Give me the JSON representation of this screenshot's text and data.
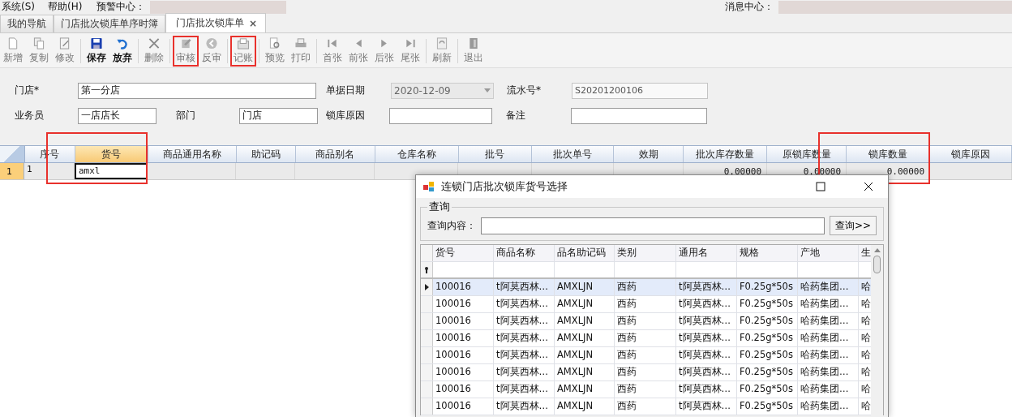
{
  "menu_bar": {
    "items": [
      "系统(S)",
      "帮助(H)"
    ],
    "alert_label": "预警中心：",
    "message_label": "消息中心："
  },
  "tabs": [
    {
      "label": "我的导航",
      "selected": false
    },
    {
      "label": "门店批次锁库单序时簿",
      "selected": false
    },
    {
      "label": "门店批次锁库单",
      "selected": true,
      "close": "×"
    }
  ],
  "toolbar": {
    "groups": [
      [
        {
          "label": "新增",
          "kind": "new",
          "disabled": true,
          "highlighted": false
        },
        {
          "label": "复制",
          "kind": "copy",
          "disabled": true,
          "highlighted": false
        },
        {
          "label": "修改",
          "kind": "edit",
          "disabled": true,
          "highlighted": false
        }
      ],
      [
        {
          "label": "保存",
          "kind": "save",
          "disabled": false,
          "highlighted": false
        },
        {
          "label": "放弃",
          "kind": "undo",
          "disabled": false,
          "highlighted": false
        }
      ],
      [
        {
          "label": "删除",
          "kind": "delete",
          "disabled": true,
          "highlighted": false
        }
      ],
      [
        {
          "label": "审核",
          "kind": "audit",
          "disabled": true,
          "highlighted": true
        },
        {
          "label": "反审",
          "kind": "back",
          "disabled": true,
          "highlighted": false
        }
      ],
      [
        {
          "label": "记账",
          "kind": "post",
          "disabled": true,
          "highlighted": true
        }
      ],
      [
        {
          "label": "预览",
          "kind": "preview",
          "disabled": true,
          "highlighted": false
        },
        {
          "label": "打印",
          "kind": "print",
          "disabled": true,
          "highlighted": false
        }
      ],
      [
        {
          "label": "首张",
          "kind": "first",
          "disabled": true,
          "highlighted": false
        },
        {
          "label": "前张",
          "kind": "prev",
          "disabled": true,
          "highlighted": false
        },
        {
          "label": "后张",
          "kind": "next",
          "disabled": true,
          "highlighted": false
        },
        {
          "label": "尾张",
          "kind": "last",
          "disabled": true,
          "highlighted": false
        }
      ],
      [
        {
          "label": "刷新",
          "kind": "refresh",
          "disabled": true,
          "highlighted": false
        }
      ],
      [
        {
          "label": "退出",
          "kind": "exit",
          "disabled": true,
          "highlighted": false
        }
      ]
    ]
  },
  "form": {
    "fields": [
      {
        "label": "门店*",
        "value": "第一分店",
        "kind": "text",
        "disabled": false
      },
      {
        "label": "单据日期",
        "value": "2020-12-09",
        "kind": "date",
        "disabled": true
      },
      {
        "label": "流水号*",
        "value": "S20201200106",
        "kind": "text",
        "disabled": true
      },
      {
        "label": "业务员",
        "value": "一店店长",
        "kind": "text",
        "disabled": false
      },
      {
        "label": "部门",
        "value": "门店",
        "kind": "text",
        "disabled": false
      },
      {
        "label": "锁库原因",
        "kind": "text",
        "disabled": false
      },
      {
        "label": "备注",
        "kind": "text",
        "disabled": false
      }
    ]
  },
  "grid": {
    "columns": [
      {
        "label": "序号",
        "selected": false,
        "highlighted": false
      },
      {
        "label": "货号",
        "selected": true,
        "highlighted": true
      },
      {
        "label": "商品通用名称",
        "selected": false,
        "highlighted": false
      },
      {
        "label": "助记码",
        "selected": false,
        "highlighted": false
      },
      {
        "label": "商品别名",
        "selected": false,
        "highlighted": false
      },
      {
        "label": "仓库名称",
        "selected": false,
        "highlighted": false
      },
      {
        "label": "批号",
        "selected": false,
        "highlighted": false
      },
      {
        "label": "批次单号",
        "selected": false,
        "highlighted": false
      },
      {
        "label": "效期",
        "selected": false,
        "highlighted": false
      },
      {
        "label": "批次库存数量",
        "selected": false,
        "highlighted": false
      },
      {
        "label": "原锁库数量",
        "selected": false,
        "highlighted": false
      },
      {
        "label": "锁库数量",
        "selected": false,
        "highlighted": true
      },
      {
        "label": "锁库原因",
        "selected": false,
        "highlighted": false
      }
    ],
    "rows": [
      {
        "number": "1",
        "selected": true,
        "seq": "1",
        "item_no": {
          "value": "amxl",
          "editing": true
        },
        "batch_stock_qty": "0.00000",
        "original_lock_qty": "0.00000",
        "lock_qty": "0.00000"
      }
    ]
  },
  "dialog": {
    "title": "连锁门店批次锁库货号选择",
    "group_title": "查询",
    "search_label": "查询内容：",
    "search_button": "查询>>",
    "columns": [
      "货号",
      "商品名称",
      "品名助记码",
      "类别",
      "通用名",
      "规格",
      "产地",
      "生"
    ],
    "rows": [
      {
        "selected": true,
        "cells": [
          "100016",
          "t阿莫西林…",
          "AMXLJN",
          "西药",
          "t阿莫西林…",
          "F0.25g*50s",
          "哈药集团…",
          "哈"
        ]
      },
      {
        "selected": false,
        "cells": [
          "100016",
          "t阿莫西林…",
          "AMXLJN",
          "西药",
          "t阿莫西林…",
          "F0.25g*50s",
          "哈药集团…",
          "哈"
        ]
      },
      {
        "selected": false,
        "cells": [
          "100016",
          "t阿莫西林…",
          "AMXLJN",
          "西药",
          "t阿莫西林…",
          "F0.25g*50s",
          "哈药集团…",
          "哈"
        ]
      },
      {
        "selected": false,
        "cells": [
          "100016",
          "t阿莫西林…",
          "AMXLJN",
          "西药",
          "t阿莫西林…",
          "F0.25g*50s",
          "哈药集团…",
          "哈"
        ]
      },
      {
        "selected": false,
        "cells": [
          "100016",
          "t阿莫西林…",
          "AMXLJN",
          "西药",
          "t阿莫西林…",
          "F0.25g*50s",
          "哈药集团…",
          "哈"
        ]
      },
      {
        "selected": false,
        "cells": [
          "100016",
          "t阿莫西林…",
          "AMXLJN",
          "西药",
          "t阿莫西林…",
          "F0.25g*50s",
          "哈药集团…",
          "哈"
        ]
      },
      {
        "selected": false,
        "cells": [
          "100016",
          "t阿莫西林…",
          "AMXLJN",
          "西药",
          "t阿莫西林…",
          "F0.25g*50s",
          "哈药集团…",
          "哈"
        ]
      },
      {
        "selected": false,
        "cells": [
          "100016",
          "t阿莫西林…",
          "AMXLJN",
          "西药",
          "t阿莫西林…",
          "F0.25g*50s",
          "哈药集团…",
          "哈"
        ]
      }
    ]
  }
}
